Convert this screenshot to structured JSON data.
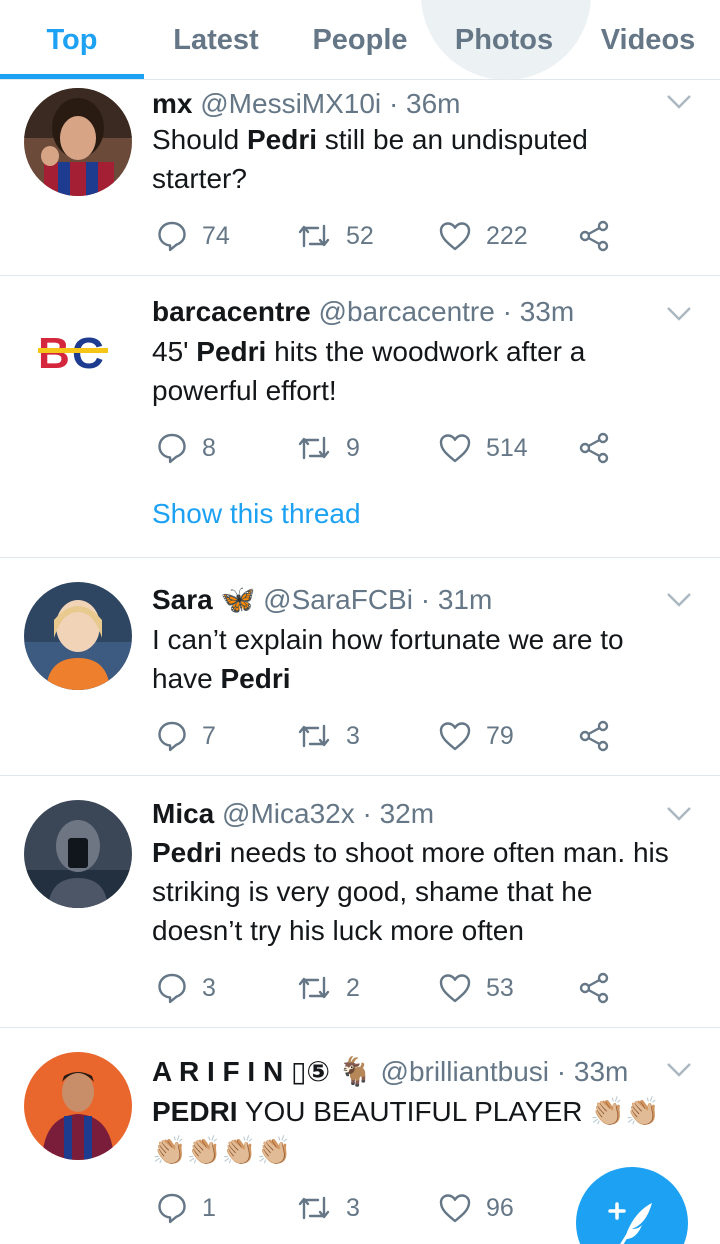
{
  "tabs": [
    {
      "label": "Top",
      "active": true
    },
    {
      "label": "Latest",
      "active": false
    },
    {
      "label": "People",
      "active": false
    },
    {
      "label": "Photos",
      "active": false
    },
    {
      "label": "Videos",
      "active": false
    }
  ],
  "tweets": [
    {
      "name": "mx",
      "handle": "@MessiMX10i",
      "time": "· 36m",
      "text_before": "Should ",
      "text_bold": "Pedri",
      "text_after": " still be an undisputed starter?",
      "replies": "74",
      "retweets": "52",
      "likes": "222"
    },
    {
      "name": "barcacentre",
      "handle": "@barcacentre",
      "time": "· 33m",
      "text_before": "45' ",
      "text_bold": "Pedri",
      "text_after": " hits the woodwork after a powerful effort!",
      "replies": "8",
      "retweets": "9",
      "likes": "514",
      "thread_link": "Show this thread"
    },
    {
      "name": "Sara",
      "name_emoji": "🦋",
      "handle": "@SaraFCBi",
      "time": "· 31m",
      "text_before": "I can’t explain how fortunate we are to have ",
      "text_bold": "Pedri",
      "text_after": "",
      "replies": "7",
      "retweets": "3",
      "likes": "79"
    },
    {
      "name": "Mica",
      "handle": "@Mica32x",
      "time": "· 32m",
      "text_before": "",
      "text_bold": "Pedri",
      "text_after": " needs to shoot more often man. his striking is very good, shame that he doesn’t try his luck more often",
      "replies": "3",
      "retweets": "2",
      "likes": "53"
    },
    {
      "name": "A R I F I N ▯⑤",
      "name_emoji": "🐐",
      "handle": "@brilliantbusi",
      "time": "· 33m",
      "text_before": "",
      "text_bold": "PEDRI",
      "text_after": " YOU BEAUTIFUL PLAYER 👏🏼👏🏼👏🏼👏🏼👏🏼👏🏼",
      "replies": "1",
      "retweets": "3",
      "likes": "96"
    }
  ],
  "colors": {
    "accent": "#1da1f2",
    "secondary_text": "#657786",
    "divider": "#e1e8ed"
  },
  "icons": {
    "reply": "reply-icon",
    "retweet": "retweet-icon",
    "like": "heart-icon",
    "share": "share-icon",
    "caret": "chevron-down-icon",
    "compose": "compose-tweet-icon"
  }
}
